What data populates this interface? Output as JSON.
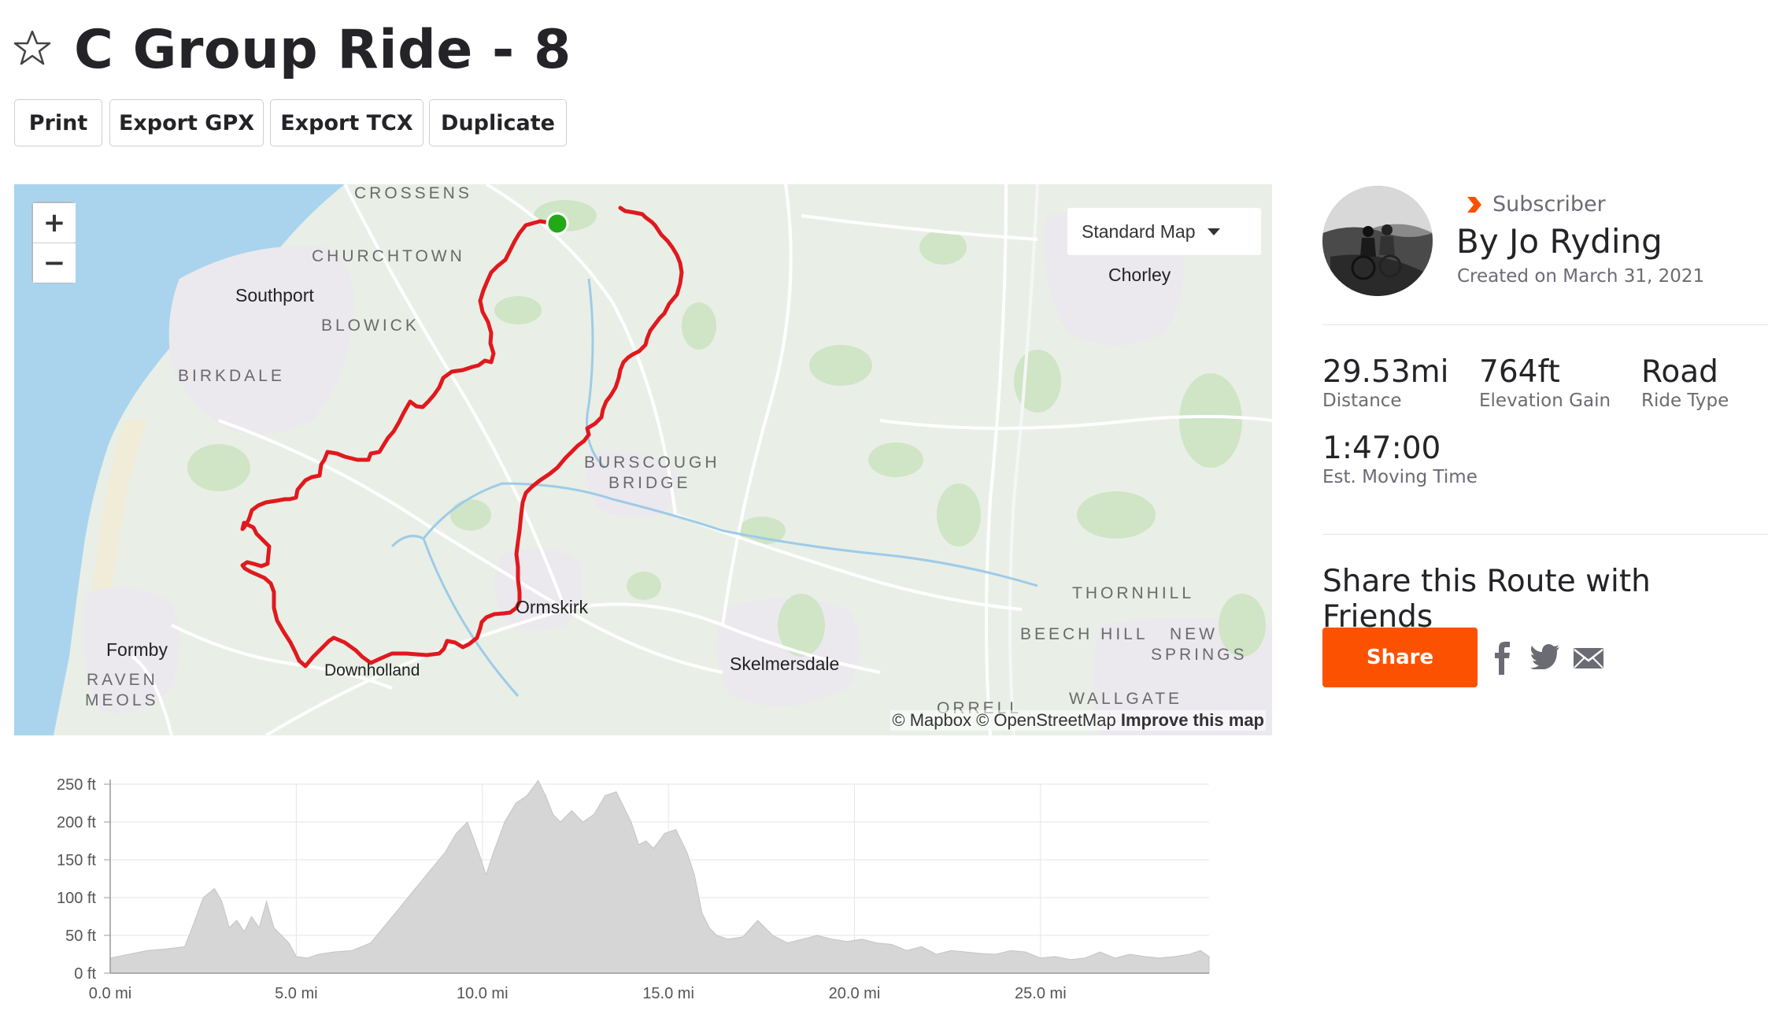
{
  "route": {
    "title": "C Group Ride - 8",
    "star_icon": "star-outline-icon"
  },
  "toolbar": {
    "print_label": "Print",
    "export_gpx_label": "Export GPX",
    "export_tcx_label": "Export TCX",
    "duplicate_label": "Duplicate"
  },
  "map": {
    "zoom_in": "+",
    "zoom_out": "−",
    "map_type": "Standard Map",
    "attribution_prefix": "© Mapbox © OpenStreetMap ",
    "attribution_link": "Improve this map",
    "route_color": "#e0191f",
    "start_marker_color": "#23a818",
    "places": [
      {
        "id": "crossens",
        "label": "CROSSENS"
      },
      {
        "id": "churchtown",
        "label": "CHURCHTOWN"
      },
      {
        "id": "southport",
        "label": "Southport"
      },
      {
        "id": "blowick",
        "label": "BLOWICK"
      },
      {
        "id": "birkdale",
        "label": "BIRKDALE"
      },
      {
        "id": "burscough",
        "label": "BURSCOUGH"
      },
      {
        "id": "bridge",
        "label": "BRIDGE"
      },
      {
        "id": "chorley",
        "label": "Chorley"
      },
      {
        "id": "ormskirk",
        "label": "Ormskirk"
      },
      {
        "id": "skelmersdale",
        "label": "Skelmersdale"
      },
      {
        "id": "formby",
        "label": "Formby"
      },
      {
        "id": "raven",
        "label": "RAVEN"
      },
      {
        "id": "meols",
        "label": "MEOLS"
      },
      {
        "id": "downholland",
        "label": "Downholland"
      },
      {
        "id": "thornhill",
        "label": "THORNHILL"
      },
      {
        "id": "beech_hill",
        "label": "BEECH HILL"
      },
      {
        "id": "new",
        "label": "NEW"
      },
      {
        "id": "springs",
        "label": "SPRINGS"
      },
      {
        "id": "wallgate",
        "label": "WALLGATE"
      },
      {
        "id": "orrell",
        "label": "ORRELL"
      }
    ]
  },
  "author": {
    "badge": "Subscriber",
    "name": "By Jo Ryding",
    "created": "Created on March 31, 2021",
    "badge_color": "#fc5200"
  },
  "stats": {
    "distance_value": "29.53mi",
    "distance_label": "Distance",
    "elevation_value": "764ft",
    "elevation_label": "Elevation Gain",
    "type_value": "Road",
    "type_label": "Ride Type",
    "time_value": "1:47:00",
    "time_label": "Est. Moving Time"
  },
  "share": {
    "heading": "Share this Route with Friends",
    "button_label": "Share",
    "button_color": "#fc5200",
    "icons": [
      "facebook-icon",
      "twitter-icon",
      "email-icon"
    ]
  },
  "chart_data": {
    "type": "area",
    "xlabel": "",
    "ylabel": "",
    "x_unit": "mi",
    "y_unit": "ft",
    "xlim": [
      0,
      29.53
    ],
    "ylim": [
      0,
      250
    ],
    "x_ticks": [
      "0.0 mi",
      "5.0 mi",
      "10.0 mi",
      "15.0 mi",
      "20.0 mi",
      "25.0 mi"
    ],
    "y_ticks": [
      "0 ft",
      "50 ft",
      "100 ft",
      "150 ft",
      "200 ft",
      "250 ft"
    ],
    "grid": true,
    "fill_color": "#d6d6d6",
    "x": [
      0,
      0.5,
      1.0,
      1.5,
      2.0,
      2.2,
      2.5,
      2.8,
      3.0,
      3.2,
      3.4,
      3.6,
      3.8,
      4.0,
      4.2,
      4.4,
      4.6,
      4.8,
      5.0,
      5.3,
      5.6,
      6.0,
      6.5,
      7.0,
      7.5,
      8.0,
      8.5,
      9.0,
      9.3,
      9.6,
      9.9,
      10.1,
      10.3,
      10.6,
      10.9,
      11.2,
      11.5,
      11.7,
      11.9,
      12.1,
      12.4,
      12.7,
      13.0,
      13.3,
      13.6,
      13.8,
      14.0,
      14.2,
      14.4,
      14.6,
      14.9,
      15.2,
      15.5,
      15.7,
      15.9,
      16.1,
      16.3,
      16.6,
      17.0,
      17.4,
      17.8,
      18.2,
      18.6,
      19.0,
      19.4,
      19.8,
      20.2,
      20.6,
      21.0,
      21.4,
      21.8,
      22.2,
      22.6,
      23.0,
      23.4,
      23.8,
      24.2,
      24.6,
      25.0,
      25.4,
      25.8,
      26.2,
      26.6,
      27.0,
      27.4,
      27.8,
      28.2,
      28.6,
      29.0,
      29.3,
      29.53
    ],
    "values": [
      20,
      25,
      30,
      32,
      35,
      60,
      100,
      112,
      95,
      60,
      70,
      55,
      75,
      60,
      95,
      60,
      50,
      40,
      22,
      20,
      25,
      28,
      30,
      40,
      70,
      100,
      130,
      160,
      185,
      200,
      160,
      130,
      160,
      200,
      225,
      235,
      255,
      235,
      210,
      200,
      215,
      200,
      210,
      235,
      240,
      220,
      200,
      170,
      175,
      165,
      185,
      190,
      160,
      130,
      80,
      60,
      50,
      45,
      48,
      70,
      50,
      40,
      45,
      50,
      45,
      42,
      45,
      40,
      38,
      30,
      35,
      25,
      30,
      28,
      26,
      25,
      30,
      28,
      20,
      22,
      18,
      20,
      28,
      20,
      25,
      22,
      20,
      22,
      25,
      30,
      22
    ]
  }
}
